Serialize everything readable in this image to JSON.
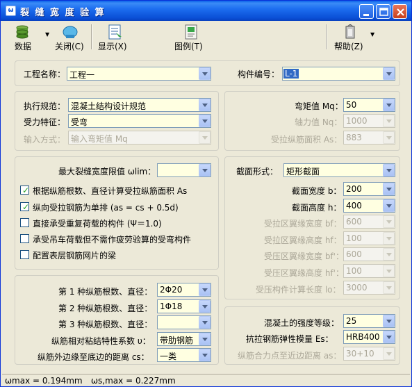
{
  "window": {
    "title": "裂 缝 宽 度 验 算",
    "icon": "app-icon"
  },
  "toolbar": {
    "data": "数据",
    "close": "关闭(C)",
    "show": "显示(X)",
    "legend": "图例(T)",
    "help": "帮助(Z)"
  },
  "project": {
    "name_label": "工程名称：",
    "name_value": "工程一",
    "id_label": "构件编号：",
    "id_value": "L-1"
  },
  "code": {
    "code_label": "执行规范：",
    "code_value": "混凝土结构设计规范",
    "force_label": "受力特征：",
    "force_value": "受弯",
    "input_label": "输入方式：",
    "input_value": "输入弯矩值 Mq"
  },
  "loads": {
    "mq_label": "弯矩值 Mq：",
    "mq_value": "50",
    "nq_label": "轴力值 Nq：",
    "nq_value": "1000",
    "as_label": "受拉纵筋面积 As：",
    "as_value": "883"
  },
  "options": {
    "wlim_label": "最大裂缝宽度限值 ωlim：",
    "wlim_value": "",
    "checks": [
      {
        "label": "根据纵筋根数、直径计算受拉纵筋面积 As",
        "checked": true
      },
      {
        "label": "纵向受拉钢筋为单排  (as = cs + 0.5d)",
        "checked": true
      },
      {
        "label": "直接承受重复荷载的构件  (Ψ＝1.0)",
        "checked": false
      },
      {
        "label": "承受吊车荷载但不需作疲劳验算的受弯构件",
        "checked": false
      },
      {
        "label": "配置表层钢筋网片的梁",
        "checked": false
      }
    ]
  },
  "section": {
    "shape_label": "截面形式：",
    "shape_value": "矩形截面",
    "b_label": "截面宽度 b：",
    "b_value": "200",
    "h_label": "截面高度 h：",
    "h_value": "400",
    "bf_label": "受拉区翼缘宽度 bf：",
    "bf_value": "600",
    "hf_label": "受拉区翼缘高度 hf：",
    "hf_value": "100",
    "bf2_label": "受压区翼缘宽度 bf'：",
    "bf2_value": "600",
    "hf2_label": "受压区翼缘高度 hf'：",
    "hf2_value": "100",
    "lo_label": "受压构件计算长度 lo：",
    "lo_value": "3000"
  },
  "rebar": {
    "r1_label": "第 1 种纵筋根数、直径：",
    "r1_value": "2Φ20",
    "r2_label": "第 2 种纵筋根数、直径：",
    "r2_value": "1Φ18",
    "r3_label": "第 3 种纵筋根数、直径：",
    "r3_value": "",
    "u_label": "纵筋相对粘结特性系数 υ：",
    "u_value": "带肋钢筋",
    "cs_label": "纵筋外边缘至底边的距离 cs：",
    "cs_value": "一类"
  },
  "material": {
    "conc_label": "混凝土的强度等级：",
    "conc_value": "25",
    "es_label": "抗拉钢筋弹性模量 Es：",
    "es_value": "HRB400",
    "as_label": "纵筋合力点至近边距离 as：",
    "as_value": "30+10"
  },
  "status": {
    "wmax": "ωmax = 0.194mm",
    "ws": "ωs,max = 0.227mm"
  },
  "colors": {
    "title_bar": "#0a4fd6",
    "selection": "#316ac5",
    "check": "#21a121"
  }
}
